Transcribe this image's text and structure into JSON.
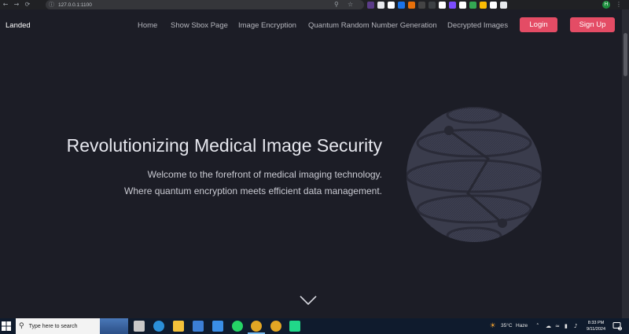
{
  "browser": {
    "url": "127.0.0.1:1100",
    "profile_initial": "H",
    "extension_colors": [
      "#5b3c88",
      "#e8eaed",
      "#ffffff",
      "#1a73e8",
      "#e8710a",
      "#444444",
      "#3c4043",
      "#ffffff",
      "#7c4dff",
      "#ffffff",
      "#34a853",
      "#fbbc04",
      "#ffffff",
      "#e8eaed"
    ]
  },
  "nav": {
    "brand": "Landed",
    "links": [
      "Home",
      "Show Sbox Page",
      "Image Encryption",
      "Quantum Random Number Generation",
      "Decrypted Images"
    ],
    "login_label": "Login",
    "signup_label": "Sign Up"
  },
  "hero": {
    "title": "Revolutionizing Medical Image Security",
    "line1": "Welcome to the forefront of medical imaging technology.",
    "line2": "Where quantum encryption meets efficient data management."
  },
  "colors": {
    "background": "#1c1d26",
    "accent": "#e44c65",
    "logo": "#3b3d4f"
  },
  "taskbar": {
    "search_placeholder": "Type here to search",
    "weather_temp": "35°C",
    "weather_desc": "Haze",
    "time": "8:33 PM",
    "date": "9/11/2024",
    "notification_count": "3",
    "pinned_apps": [
      "task-view-icon",
      "edge-icon",
      "file-explorer-icon",
      "store-icon",
      "mail-icon",
      "whatsapp-icon",
      "chrome-icon",
      "chrome-icon",
      "pycharm-icon"
    ]
  }
}
